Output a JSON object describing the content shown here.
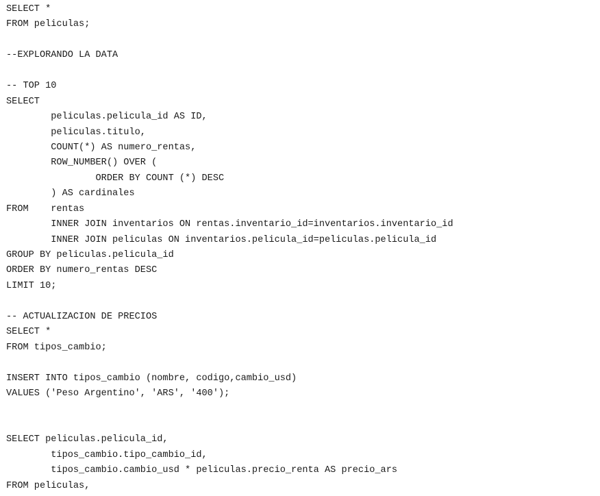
{
  "editor": {
    "lines": [
      "SELECT *",
      "FROM peliculas;",
      "",
      "--EXPLORANDO LA DATA",
      "",
      "-- TOP 10",
      "SELECT",
      "        peliculas.pelicula_id AS ID,",
      "        peliculas.titulo,",
      "        COUNT(*) AS numero_rentas,",
      "        ROW_NUMBER() OVER (",
      "                ORDER BY COUNT (*) DESC",
      "        ) AS cardinales",
      "FROM    rentas",
      "        INNER JOIN inventarios ON rentas.inventario_id=inventarios.inventario_id",
      "        INNER JOIN peliculas ON inventarios.pelicula_id=peliculas.pelicula_id",
      "GROUP BY peliculas.pelicula_id",
      "ORDER BY numero_rentas DESC",
      "LIMIT 10;",
      "",
      "-- ACTUALIZACION DE PRECIOS",
      "SELECT *",
      "FROM tipos_cambio;",
      "",
      "INSERT INTO tipos_cambio (nombre, codigo,cambio_usd)",
      "VALUES ('Peso Argentino', 'ARS', '400');",
      "",
      "",
      "SELECT peliculas.pelicula_id,",
      "        tipos_cambio.tipo_cambio_id,",
      "        tipos_cambio.cambio_usd * peliculas.precio_renta AS precio_ars",
      "FROM peliculas,"
    ]
  }
}
